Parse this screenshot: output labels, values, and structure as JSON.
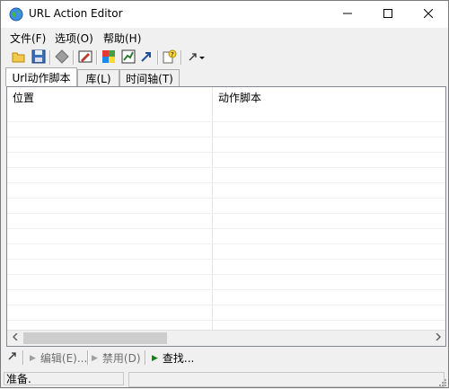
{
  "window": {
    "title": "URL Action Editor"
  },
  "menu": [
    {
      "label": "文件(F)"
    },
    {
      "label": "选项(O)"
    },
    {
      "label": "帮助(H)"
    }
  ],
  "toolbar": {
    "icons": [
      "open-folder-icon",
      "save-disk-icon",
      "diamond-icon",
      "edit-script-icon",
      "color-grid-icon",
      "chart-icon",
      "arrow-icon",
      "help-icon",
      "dropdown-arrow-icon"
    ]
  },
  "tabs": [
    {
      "label": "Url动作脚本",
      "active": true
    },
    {
      "label": "库(L)"
    },
    {
      "label": "时间轴(T)"
    }
  ],
  "table": {
    "columns": [
      "位置",
      "动作脚本"
    ],
    "rows": []
  },
  "actions": {
    "edit": "编辑(E)...",
    "disable": "禁用(D)",
    "find": "查找..."
  },
  "status": {
    "text": "准备."
  },
  "colors": {
    "accent": "#1a7f1a",
    "disabled_text": "#6d6d6d"
  }
}
